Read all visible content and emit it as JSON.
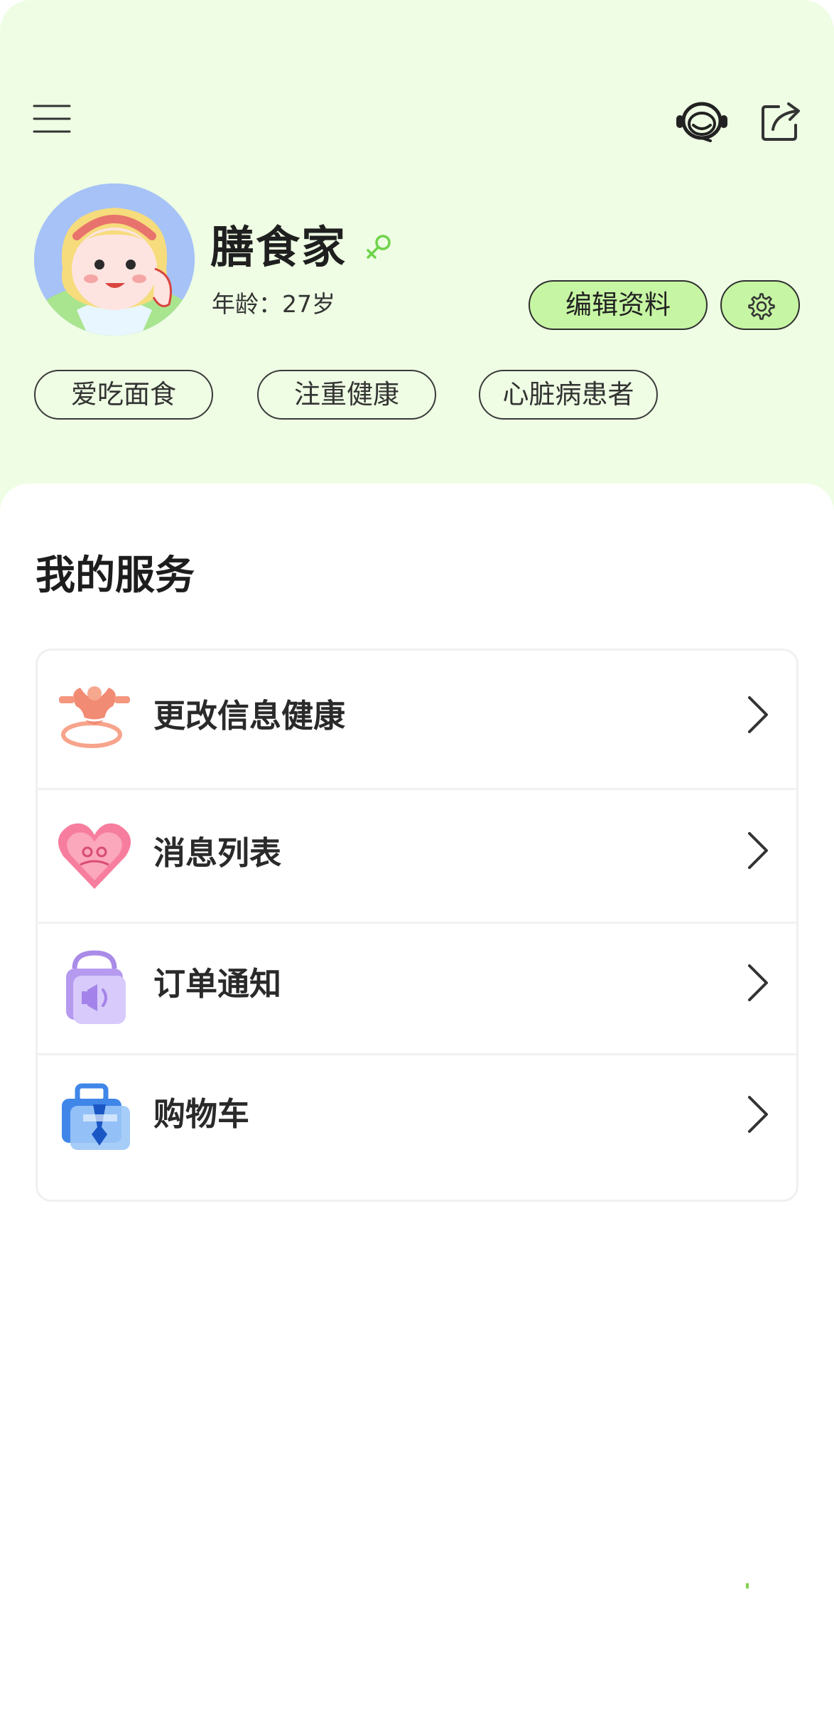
{
  "colors": {
    "header_bg": "#eefde3",
    "accent_green": "#c6f5a3",
    "gender_icon": "#6fd34a"
  },
  "header": {
    "icons": [
      "menu-icon",
      "headset-icon",
      "share-icon"
    ]
  },
  "profile": {
    "name": "膳食家",
    "age": "年龄：27岁",
    "edit_label": "编辑资料",
    "tags": [
      "爱吃面食",
      "注重健康",
      "心脏病患者"
    ]
  },
  "services": {
    "title": "我的服务",
    "items": [
      {
        "label": "更改信息健康",
        "icon": "fitness-icon"
      },
      {
        "label": "消息列表",
        "icon": "heart-message-icon"
      },
      {
        "label": "订单通知",
        "icon": "order-bag-icon"
      },
      {
        "label": "购物车",
        "icon": "shopping-bag-icon"
      }
    ]
  }
}
